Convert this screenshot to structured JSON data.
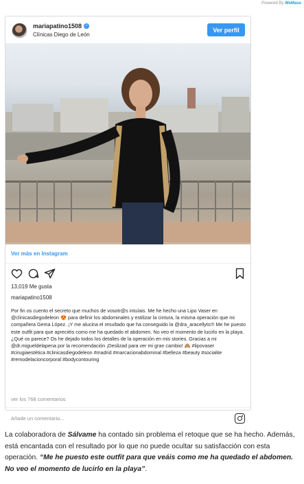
{
  "powered": {
    "prefix": "Powered By ",
    "brand": "WeMass"
  },
  "post": {
    "username": "mariapatino1508",
    "verified_icon": "✓",
    "location": "Clínicas Diego de León",
    "follow_label": "Ver perfil",
    "view_more": "Ver más en Instagram",
    "likes": "13,019 Me gusta",
    "owner": "mariapatino1508",
    "caption": "Por fin os cuento el secreto que muchos de vosotr@s intuíais. Me he hecho una Lipo Vaser en @clinicasdiegodeleon 😍 para definir los abdominales y estilizar la cintura, la misma operación que mi compañera Gema López. ¡Y me alucina el resultado que ha conseguido la @dra_aracellyts!!! Me he puesto este outfit para que apreciéis como me ha quedado el abdomen. No veo el momento de lucirlo en la playa. ¿Qué os parece? Os he dejado todos los detalles de la operación en mis stories. Gracias a mi @dr.migueldelapena por la recomendación ¡Deslizad para ver mi gran cambio! 🙈 #lipovaser #cirugiaestética #clinicasdiegodeleon #madrid #marcacionabdominal #belleza #beauty #socialite #remodelacioncorporal #bodycontouring",
    "comments": "ver los 768 comentarios",
    "comment_placeholder": "Añade un comentario..."
  },
  "article": {
    "part1": "La colaboradora de ",
    "show": "Sálvame",
    "part2": " ha contado sin problema el retoque que se ha hecho. Además, está encantada con el resultado por lo que no puede ocultar su satisfacción con esta operación. ",
    "quote": "“Me he puesto este outfit para que veáis como me ha quedado el abdomen. No veo el momento de lucirlo en la playa”",
    "end": "."
  },
  "colors": {
    "accent": "#3897f0",
    "border": "#dbdbdb"
  }
}
